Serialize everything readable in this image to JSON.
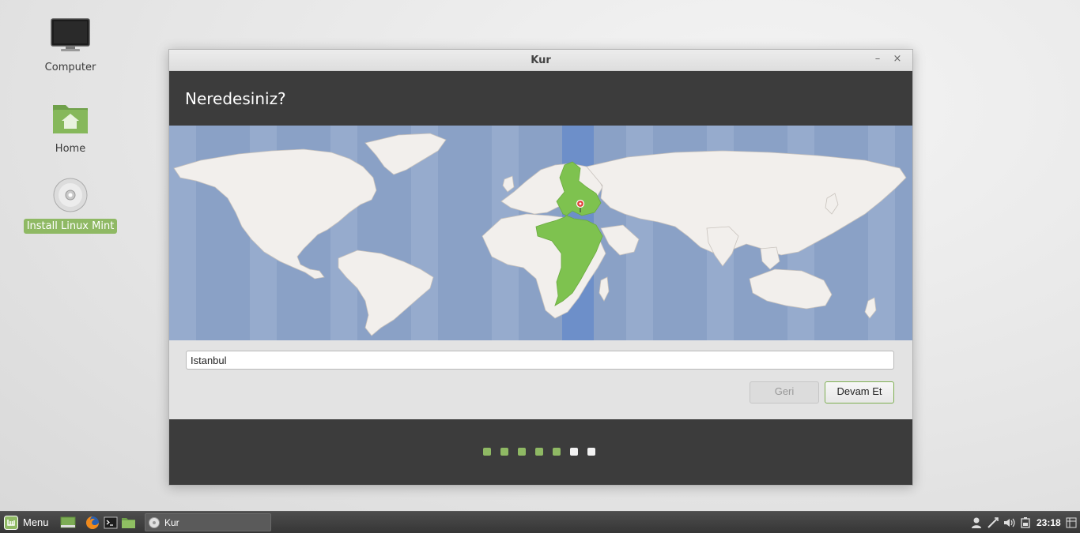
{
  "desktop": {
    "icons": [
      {
        "label": "Computer",
        "icon": "monitor-icon"
      },
      {
        "label": "Home",
        "icon": "home-folder-icon"
      },
      {
        "label": "Install Linux Mint",
        "icon": "disc-icon"
      }
    ]
  },
  "window": {
    "title": "Kur",
    "heading": "Neredesiniz?",
    "minimize_glyph": "–",
    "close_glyph": "×",
    "city_value": "Istanbul",
    "back_label": "Geri",
    "next_label": "Devam Et",
    "progress": {
      "completed": 5,
      "total": 7
    },
    "colors": {
      "accent": "#8fb964",
      "header_bg": "#3c3c3c",
      "ocean": "#8aa1c6",
      "selected_zone": "#7ec24f"
    }
  },
  "panel": {
    "menu_label": "Menu",
    "task_label": "Kur",
    "clock": "23:18",
    "launchers": [
      "show-desktop-icon",
      "firefox-icon",
      "terminal-icon",
      "files-icon"
    ],
    "tray": [
      "user-icon",
      "network-icon",
      "volume-icon",
      "battery-icon",
      "show-desktop-tray-icon"
    ]
  }
}
